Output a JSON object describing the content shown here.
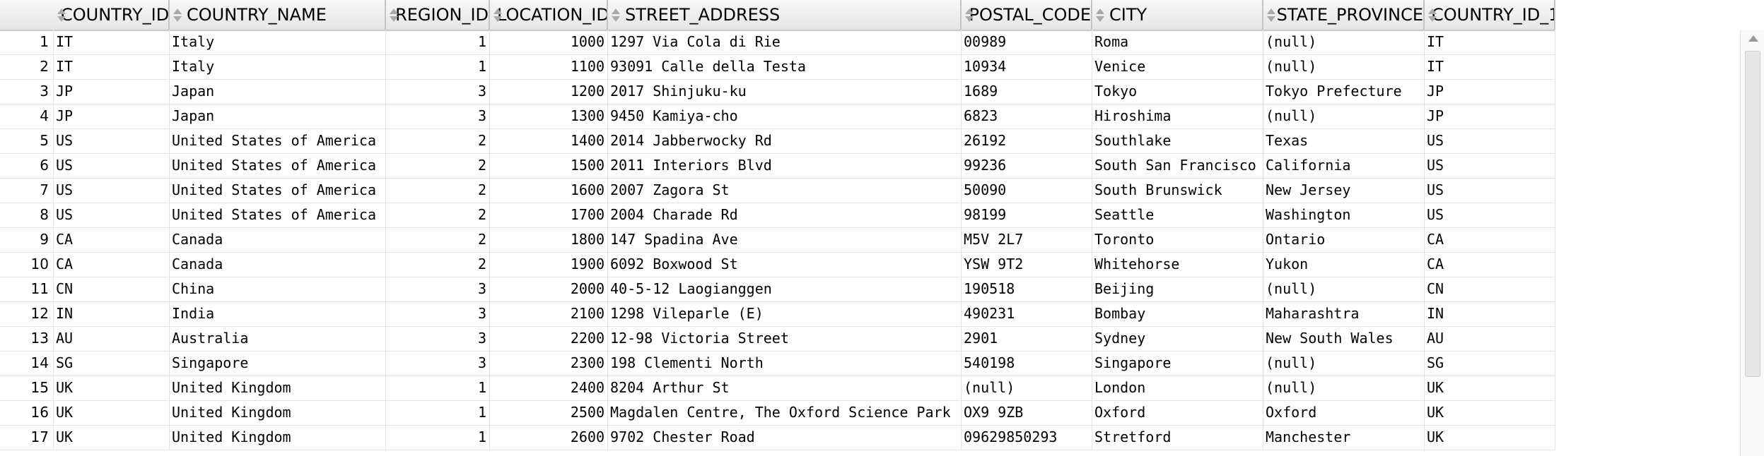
{
  "columns": [
    "COUNTRY_ID",
    "COUNTRY_NAME",
    "REGION_ID",
    "LOCATION_ID",
    "STREET_ADDRESS",
    "POSTAL_CODE",
    "CITY",
    "STATE_PROVINCE",
    "COUNTRY_ID_1"
  ],
  "rows": [
    [
      "1",
      "IT",
      "Italy",
      "1",
      "1000",
      "1297 Via Cola di Rie",
      "00989",
      "Roma",
      "(null)",
      "IT"
    ],
    [
      "2",
      "IT",
      "Italy",
      "1",
      "1100",
      "93091 Calle della Testa",
      "10934",
      "Venice",
      "(null)",
      "IT"
    ],
    [
      "3",
      "JP",
      "Japan",
      "3",
      "1200",
      "2017 Shinjuku-ku",
      "1689",
      "Tokyo",
      "Tokyo Prefecture",
      "JP"
    ],
    [
      "4",
      "JP",
      "Japan",
      "3",
      "1300",
      "9450 Kamiya-cho",
      "6823",
      "Hiroshima",
      "(null)",
      "JP"
    ],
    [
      "5",
      "US",
      "United States of America",
      "2",
      "1400",
      "2014 Jabberwocky Rd",
      "26192",
      "Southlake",
      "Texas",
      "US"
    ],
    [
      "6",
      "US",
      "United States of America",
      "2",
      "1500",
      "2011 Interiors Blvd",
      "99236",
      "South San Francisco",
      "California",
      "US"
    ],
    [
      "7",
      "US",
      "United States of America",
      "2",
      "1600",
      "2007 Zagora St",
      "50090",
      "South Brunswick",
      "New Jersey",
      "US"
    ],
    [
      "8",
      "US",
      "United States of America",
      "2",
      "1700",
      "2004 Charade Rd",
      "98199",
      "Seattle",
      "Washington",
      "US"
    ],
    [
      "9",
      "CA",
      "Canada",
      "2",
      "1800",
      "147 Spadina Ave",
      "M5V 2L7",
      "Toronto",
      "Ontario",
      "CA"
    ],
    [
      "10",
      "CA",
      "Canada",
      "2",
      "1900",
      "6092 Boxwood St",
      "YSW 9T2",
      "Whitehorse",
      "Yukon",
      "CA"
    ],
    [
      "11",
      "CN",
      "China",
      "3",
      "2000",
      "40-5-12 Laogianggen",
      "190518",
      "Beijing",
      "(null)",
      "CN"
    ],
    [
      "12",
      "IN",
      "India",
      "3",
      "2100",
      "1298 Vileparle (E)",
      "490231",
      "Bombay",
      "Maharashtra",
      "IN"
    ],
    [
      "13",
      "AU",
      "Australia",
      "3",
      "2200",
      "12-98 Victoria Street",
      "2901",
      "Sydney",
      "New South Wales",
      "AU"
    ],
    [
      "14",
      "SG",
      "Singapore",
      "3",
      "2300",
      "198 Clementi North",
      "540198",
      "Singapore",
      "(null)",
      "SG"
    ],
    [
      "15",
      "UK",
      "United Kingdom",
      "1",
      "2400",
      "8204 Arthur St",
      "(null)",
      "London",
      "(null)",
      "UK"
    ],
    [
      "16",
      "UK",
      "United Kingdom",
      "1",
      "2500",
      "Magdalen Centre, The Oxford Science Park",
      "OX9 9ZB",
      "Oxford",
      "Oxford",
      "UK"
    ],
    [
      "17",
      "UK",
      "United Kingdom",
      "1",
      "2600",
      "9702 Chester Road",
      "09629850293",
      "Stretford",
      "Manchester",
      "UK"
    ]
  ],
  "colors": {
    "header_bg": "#ececec",
    "grid_line": "#e3e3e3",
    "sort_arrow": "#a9a9a9"
  },
  "icons": {
    "sort": "sort-arrows-icon",
    "scroll_up": "scroll-up-arrow-icon"
  }
}
